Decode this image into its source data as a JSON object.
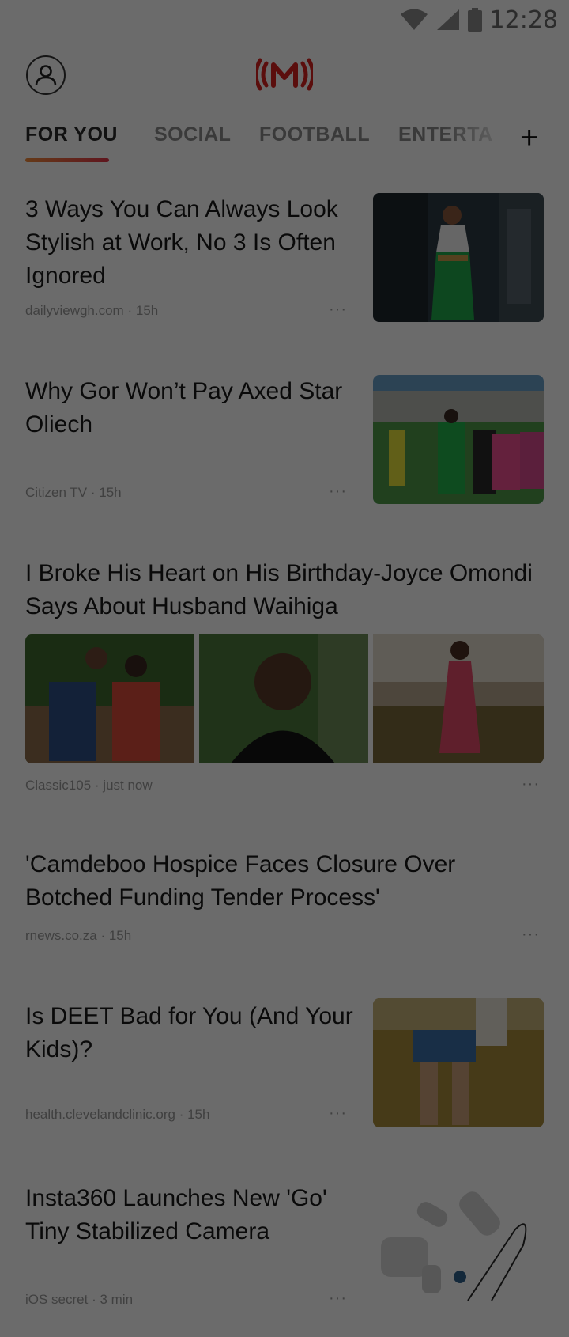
{
  "status_bar": {
    "time": "12:28",
    "icons": [
      "wifi-icon",
      "signal-icon",
      "battery-icon"
    ]
  },
  "app": {
    "logo": "m-broadcast-logo",
    "profile_icon": "person-icon"
  },
  "tabs": [
    {
      "label": "FOR YOU",
      "active": true
    },
    {
      "label": "SOCIAL",
      "active": false
    },
    {
      "label": "FOOTBALL",
      "active": false
    },
    {
      "label": "ENTERTA",
      "active": false
    }
  ],
  "add_tab_label": "+",
  "articles": [
    {
      "title": "3 Ways You Can Always Look Stylish at Work, No 3 Is Often Ignored",
      "source": "dailyviewgh.com",
      "time": "15h",
      "more": "···"
    },
    {
      "title": "Why Gor Won’t Pay Axed Star Oliech",
      "source": "Citizen TV",
      "time": "15h",
      "more": "···"
    },
    {
      "title": "I Broke His Heart on His Birthday-Joyce Omondi Says About Husband Waihiga",
      "source": "Classic105",
      "time": "just now",
      "more": "···"
    },
    {
      "title": "'Camdeboo Hospice Faces Closure Over Botched Funding Tender Process'",
      "source": "rnews.co.za",
      "time": "15h",
      "more": "···"
    },
    {
      "title": "Is DEET Bad for You (And Your Kids)?",
      "source": "health.clevelandclinic.org",
      "time": "15h",
      "more": "···"
    },
    {
      "title": "Insta360 Launches New 'Go' Tiny Stabilized Camera",
      "source": "iOS secret",
      "time": "3 min",
      "more": "···"
    }
  ],
  "meta_separator": "·",
  "colors": {
    "accent_start": "#f08a3a",
    "accent_end": "#e2354a",
    "logo": "#d9231f",
    "overlay": "rgba(0,0,0,0.58)"
  }
}
